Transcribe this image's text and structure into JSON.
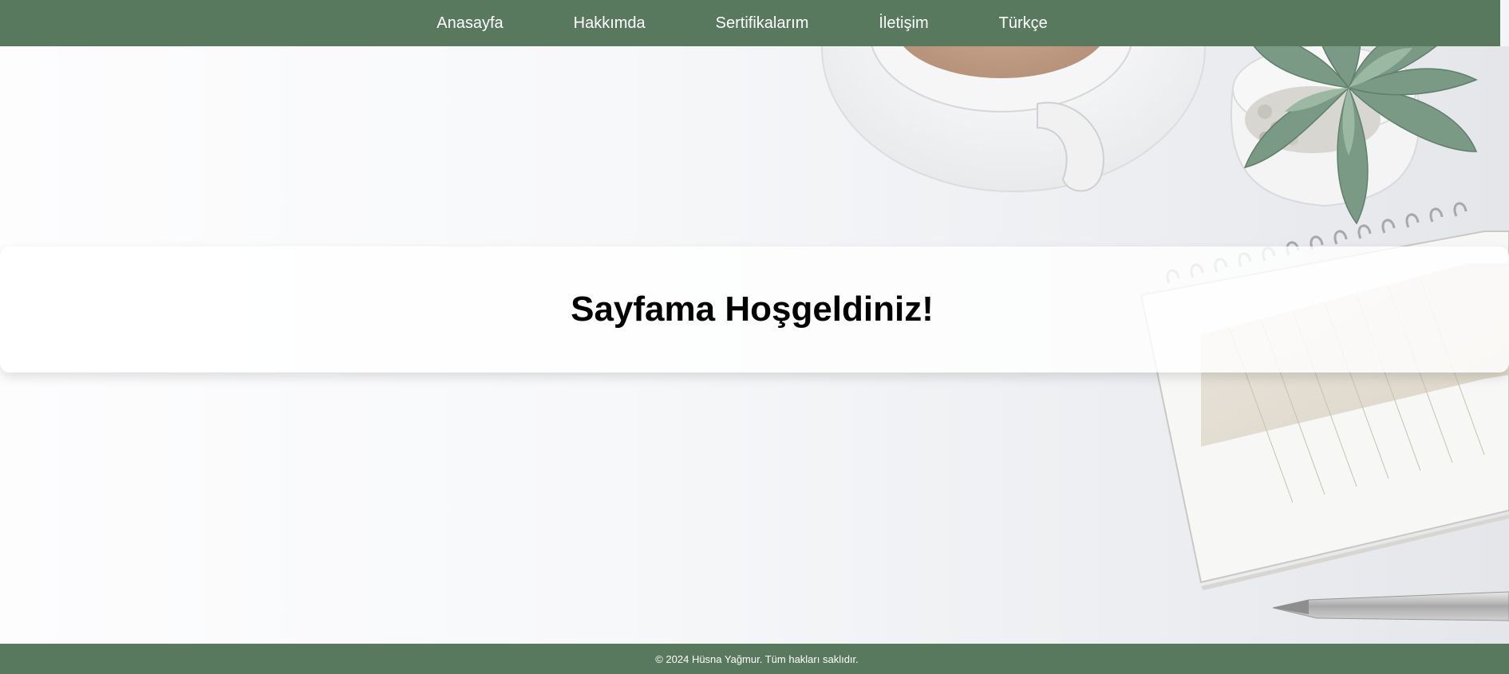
{
  "nav": {
    "items": [
      {
        "label": "Anasayfa"
      },
      {
        "label": "Hakkımda"
      },
      {
        "label": "Sertifikalarım"
      },
      {
        "label": "İletişim"
      },
      {
        "label": "Türkçe"
      }
    ]
  },
  "welcome": {
    "title": "Sayfama Hoşgeldiniz!"
  },
  "footer": {
    "text": "© 2024 Hüsna Yağmur. Tüm hakları saklıdır."
  },
  "colors": {
    "nav_bg": "#58795e",
    "footer_bg": "#58795e",
    "nav_text": "#ffffff"
  },
  "background": {
    "description_icons": [
      "coffee-cup-icon",
      "succulent-plant-icon",
      "notebook-icon",
      "pen-icon"
    ]
  }
}
